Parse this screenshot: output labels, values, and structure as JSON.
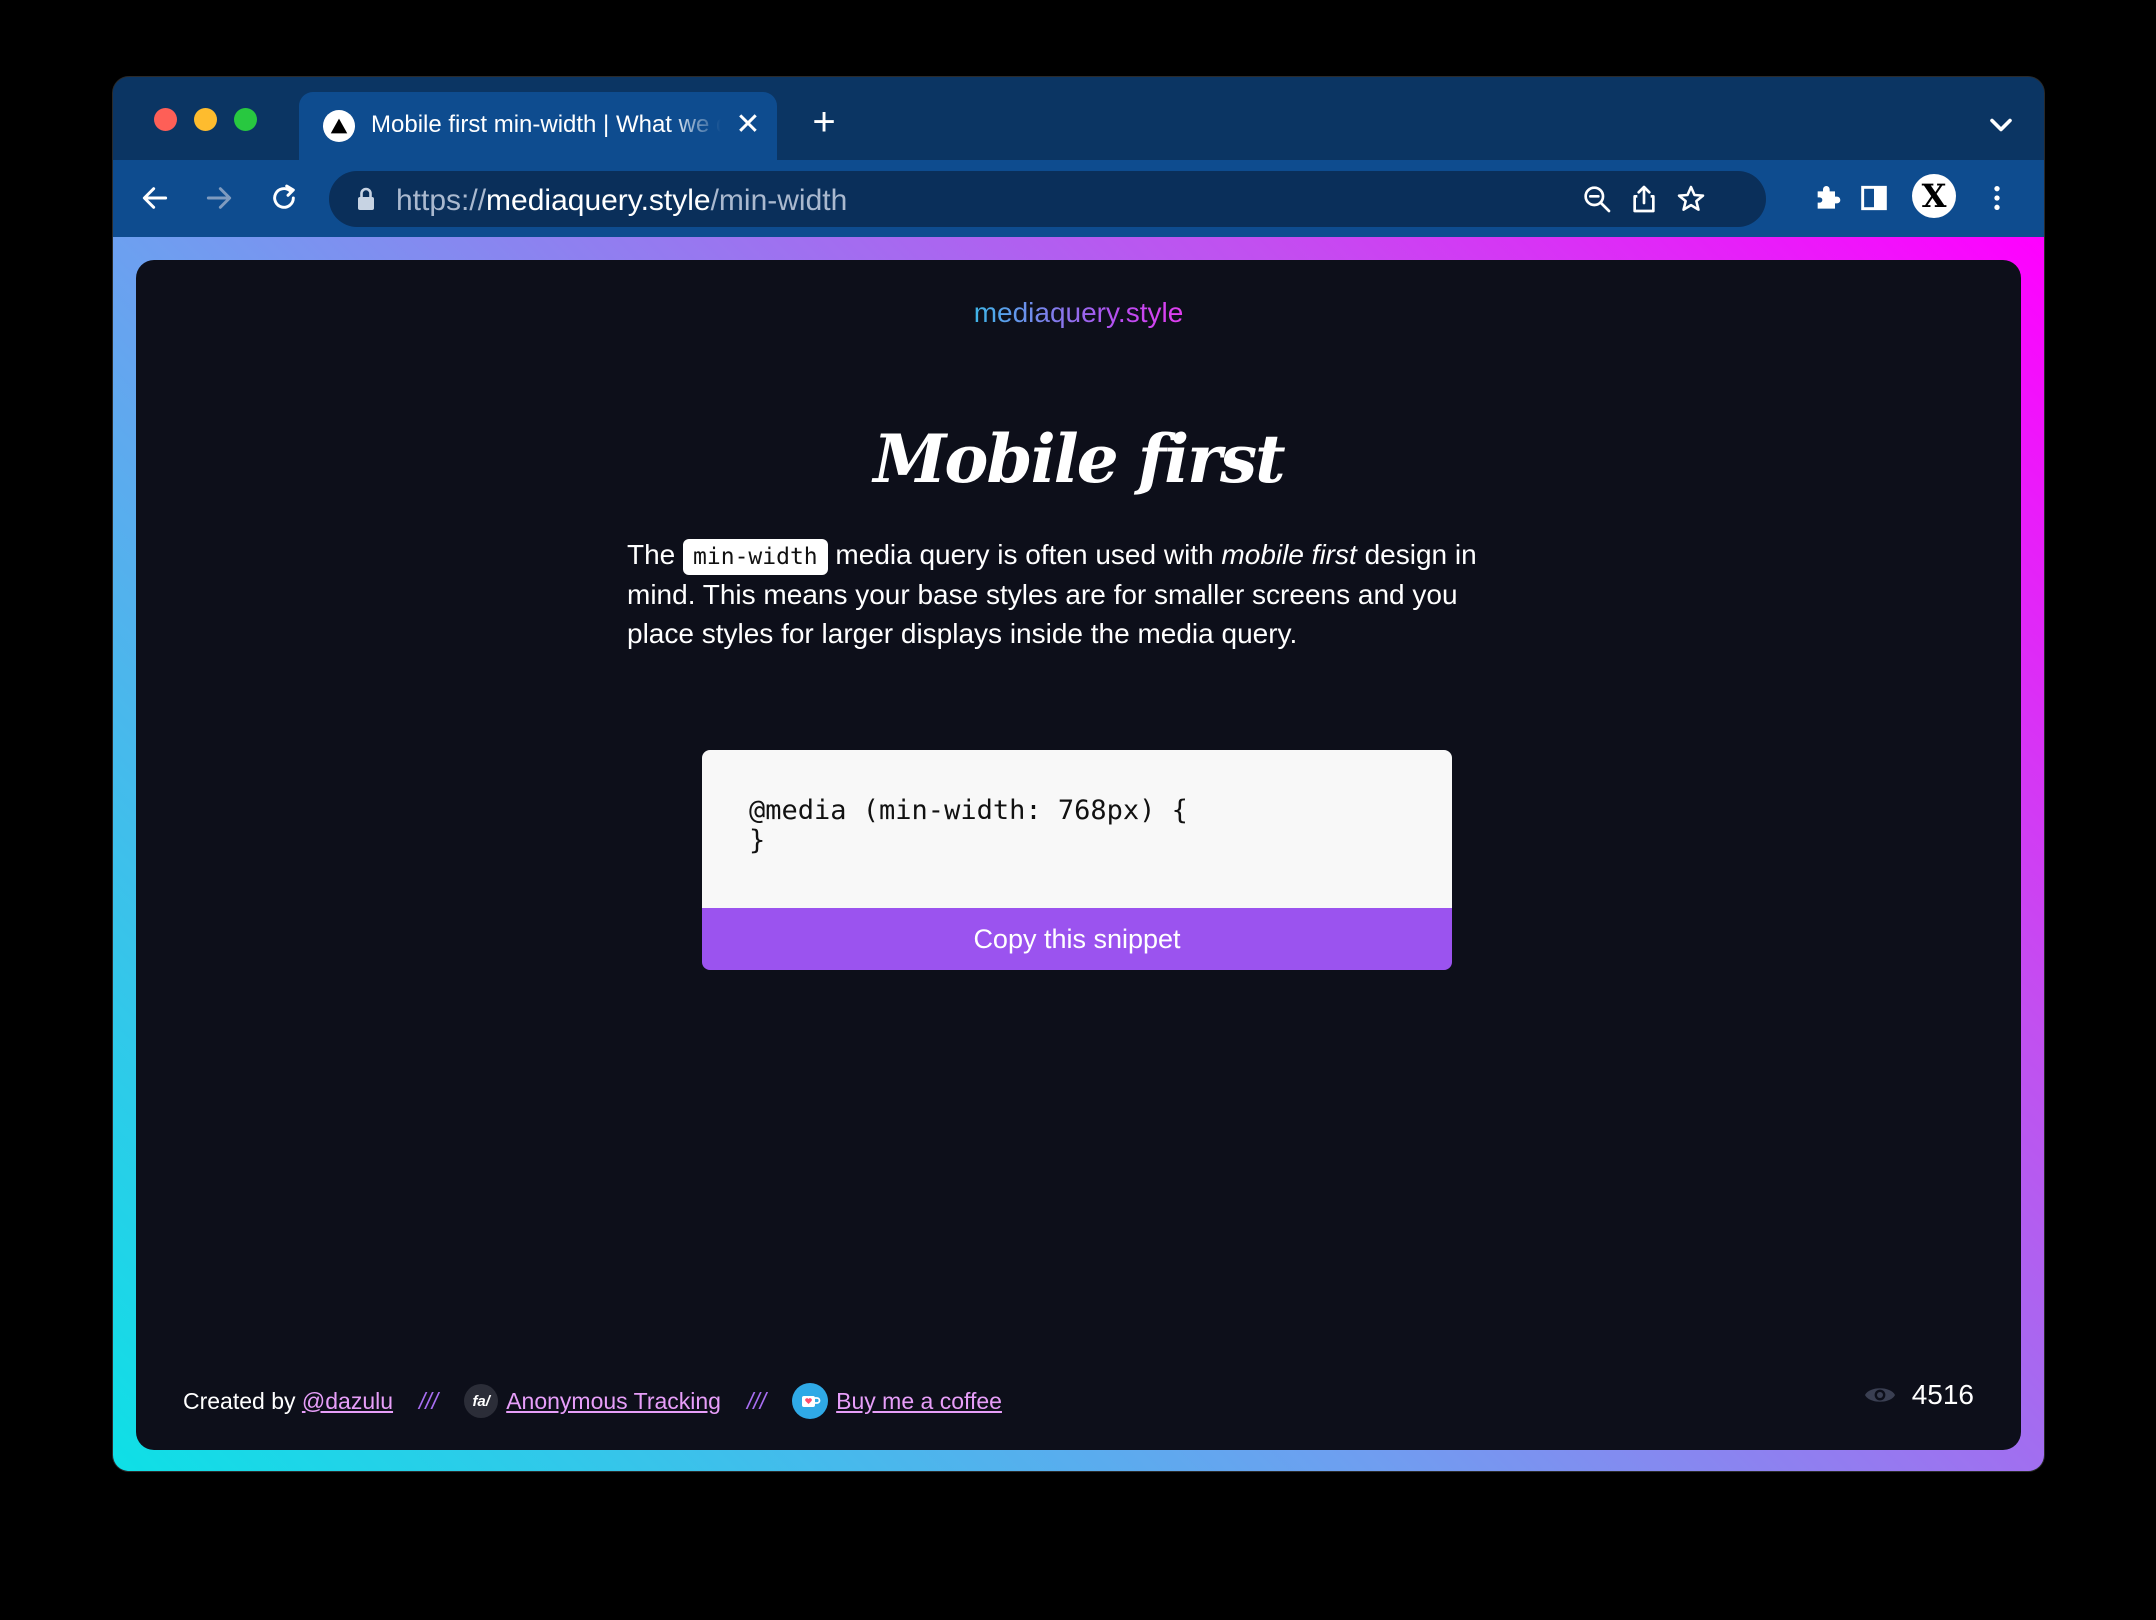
{
  "browser": {
    "tab": {
      "title": "Mobile first min-width | What we do",
      "favicon": "triangle-logo-icon"
    },
    "address_bar": {
      "scheme": "https://",
      "host": "mediaquery.style",
      "path": "/min-width"
    }
  },
  "page": {
    "brand": "mediaquery.style",
    "heading": "Mobile first",
    "intro": {
      "prefix": "The ",
      "code": "min-width",
      "middle": " media query is often used with ",
      "emphasis": "mobile first",
      "suffix": " design in mind. This means your base styles are for smaller screens and you place styles for larger displays inside the media query."
    },
    "snippet": {
      "code": "@media (min-width: 768px) {\n}",
      "copy_label": "Copy this snippet"
    },
    "footer": {
      "created_by": "Created by ",
      "author_link": "@dazulu",
      "separator": "///",
      "fa_badge": "fa/",
      "tracking_link": "Anonymous Tracking",
      "coffee_link": "Buy me a coffee",
      "view_count": "4516"
    }
  },
  "colors": {
    "brand_gradient": [
      "#3fb5e8",
      "#e23df0"
    ],
    "button": "#9b53ef",
    "link": "#e79ef9",
    "frame_gradient": [
      "#0ee0e6",
      "#ff00ff"
    ]
  }
}
